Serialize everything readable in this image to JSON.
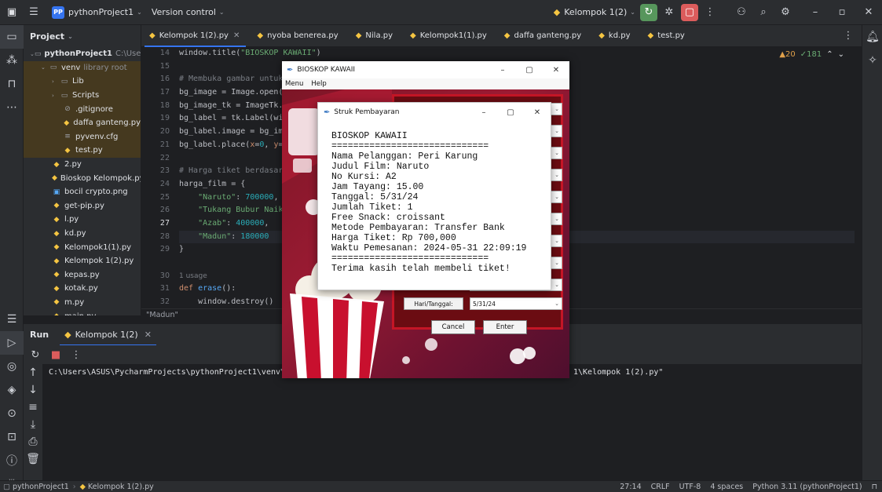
{
  "titlebar": {
    "project_badge": "PP",
    "project_name": "pythonProject1",
    "vcs": "Version control",
    "run_config": "Kelompok 1(2)"
  },
  "project_panel": {
    "title": "Project",
    "items": [
      {
        "label": "pythonProject1",
        "extra": "C:\\Use",
        "type": "root"
      },
      {
        "label": "venv",
        "extra": "library root",
        "type": "lib"
      },
      {
        "label": "Lib",
        "type": "folder"
      },
      {
        "label": "Scripts",
        "type": "folder"
      },
      {
        "label": ".gitignore",
        "type": "file"
      },
      {
        "label": "daffa ganteng.py",
        "type": "py"
      },
      {
        "label": "pyvenv.cfg",
        "type": "file"
      },
      {
        "label": "test.py",
        "type": "py"
      },
      {
        "label": "2.py",
        "type": "py"
      },
      {
        "label": "Bioskop Kelompok.py",
        "type": "py"
      },
      {
        "label": "bocil crypto.png",
        "type": "img"
      },
      {
        "label": "get-pip.py",
        "type": "py"
      },
      {
        "label": "l.py",
        "type": "py"
      },
      {
        "label": "kd.py",
        "type": "py"
      },
      {
        "label": "Kelompok1(1).py",
        "type": "py"
      },
      {
        "label": "Kelompok 1(2).py",
        "type": "py"
      },
      {
        "label": "kepas.py",
        "type": "py"
      },
      {
        "label": "kotak.py",
        "type": "py"
      },
      {
        "label": "m.py",
        "type": "py"
      },
      {
        "label": "main.py",
        "type": "py"
      }
    ]
  },
  "tabs": [
    {
      "label": "Kelompok 1(2).py",
      "active": true
    },
    {
      "label": "nyoba benerea.py"
    },
    {
      "label": "Nila.py"
    },
    {
      "label": "Kelompok1(1).py"
    },
    {
      "label": "daffa ganteng.py"
    },
    {
      "label": "kd.py"
    },
    {
      "label": "test.py"
    }
  ],
  "editor": {
    "warnings": "▲20",
    "checks": "✓181",
    "line_numbers": [
      "14",
      "15",
      "16",
      "17",
      "18",
      "19",
      "20",
      "21",
      "22",
      "23",
      "24",
      "25",
      "26",
      "27",
      "28",
      "29",
      "",
      "30",
      "31",
      "32"
    ],
    "current_line": "27",
    "usage_hint": "1 usage",
    "breadcrumb": "\"Madun\""
  },
  "run_panel": {
    "label": "Run",
    "tab": "Kelompok 1(2)",
    "console_line_start": "C:\\Users\\ASUS\\PycharmProjects\\pythonProject1\\venv\\S",
    "console_line_end": "1\\Kelompok 1(2).py\""
  },
  "statusbar": {
    "project": "pythonProject1",
    "file": "Kelompok 1(2).py",
    "position": "27:14",
    "line_sep": "CRLF",
    "encoding": "UTF-8",
    "indent": "4 spaces",
    "interpreter": "Python 3.11 (pythonProject1)"
  },
  "tk_window": {
    "title": "BIOSKOP KAWAII",
    "menu": [
      "Menu",
      "Help"
    ],
    "date_label": "Hari/Tanggal:",
    "date_value": "5/31/24",
    "cancel": "Cancel",
    "enter": "Enter"
  },
  "receipt": {
    "title": "Struk Pembayaran",
    "lines": [
      "BIOSKOP KAWAII",
      "=============================",
      "Nama Pelanggan: Peri Karung",
      "Judul Film: Naruto",
      "No Kursi: A2",
      "Jam Tayang: 15.00",
      "Tanggal: 5/31/24",
      "Jumlah Tiket: 1",
      "Free Snack: croissant",
      "Metode Pembayaran: Transfer Bank",
      "Harga Tiket: Rp 700,000",
      "Waktu Pemesanan: 2024-05-31 22:09:19",
      "=============================",
      "Terima kasih telah membeli tiket!"
    ]
  }
}
